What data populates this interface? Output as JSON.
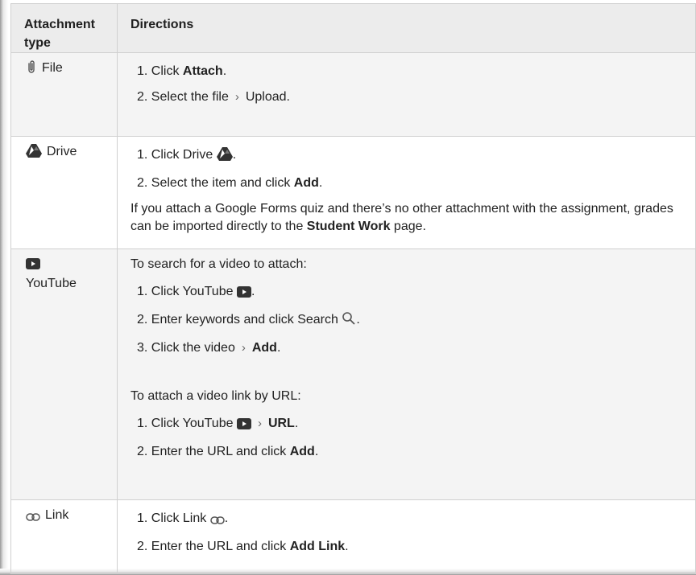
{
  "table": {
    "header_type": "Attachment type",
    "header_directions": "Directions"
  },
  "file": {
    "type_label": "File",
    "step1_prefix": "1. Click ",
    "step1_bold": "Attach",
    "step1_suffix": ".",
    "step2_prefix": "2. Select the file",
    "step2_suffix": "Upload."
  },
  "drive": {
    "type_label": "Drive",
    "step1_prefix": "1. Click Drive",
    "step1_suffix": ".",
    "step2_prefix": "2. Select the item and click ",
    "step2_bold": "Add",
    "step2_suffix": ".",
    "note_prefix": "If you attach a Google Forms quiz and there’s no other attachment with the assignment, grades can be imported directly to the ",
    "note_bold": "Student Work",
    "note_suffix": " page."
  },
  "youtube": {
    "type_label": "YouTube",
    "search_intro": "To search for a video to attach:",
    "s1_prefix": "1. Click YouTube",
    "s1_suffix": ".",
    "s2_prefix": "2. Enter keywords and click Search",
    "s2_suffix": ".",
    "s3_prefix": "3. Click the video",
    "s3_bold": "Add",
    "s3_suffix": ".",
    "url_intro": "To attach a video link by URL:",
    "u1_prefix": "1. Click YouTube",
    "u1_bold": "URL",
    "u1_suffix": ".",
    "u2_prefix": "2. Enter the URL and click ",
    "u2_bold": "Add",
    "u2_suffix": "."
  },
  "link": {
    "type_label": "Link",
    "step1_prefix": "1. Click Link",
    "step1_suffix": ".",
    "step2_prefix": "2. Enter the URL and click ",
    "step2_bold": "Add Link",
    "step2_suffix": "."
  },
  "icons": [
    "paperclip-icon",
    "drive-icon",
    "youtube-icon",
    "search-icon",
    "link-icon",
    "chevron-right-icon"
  ]
}
